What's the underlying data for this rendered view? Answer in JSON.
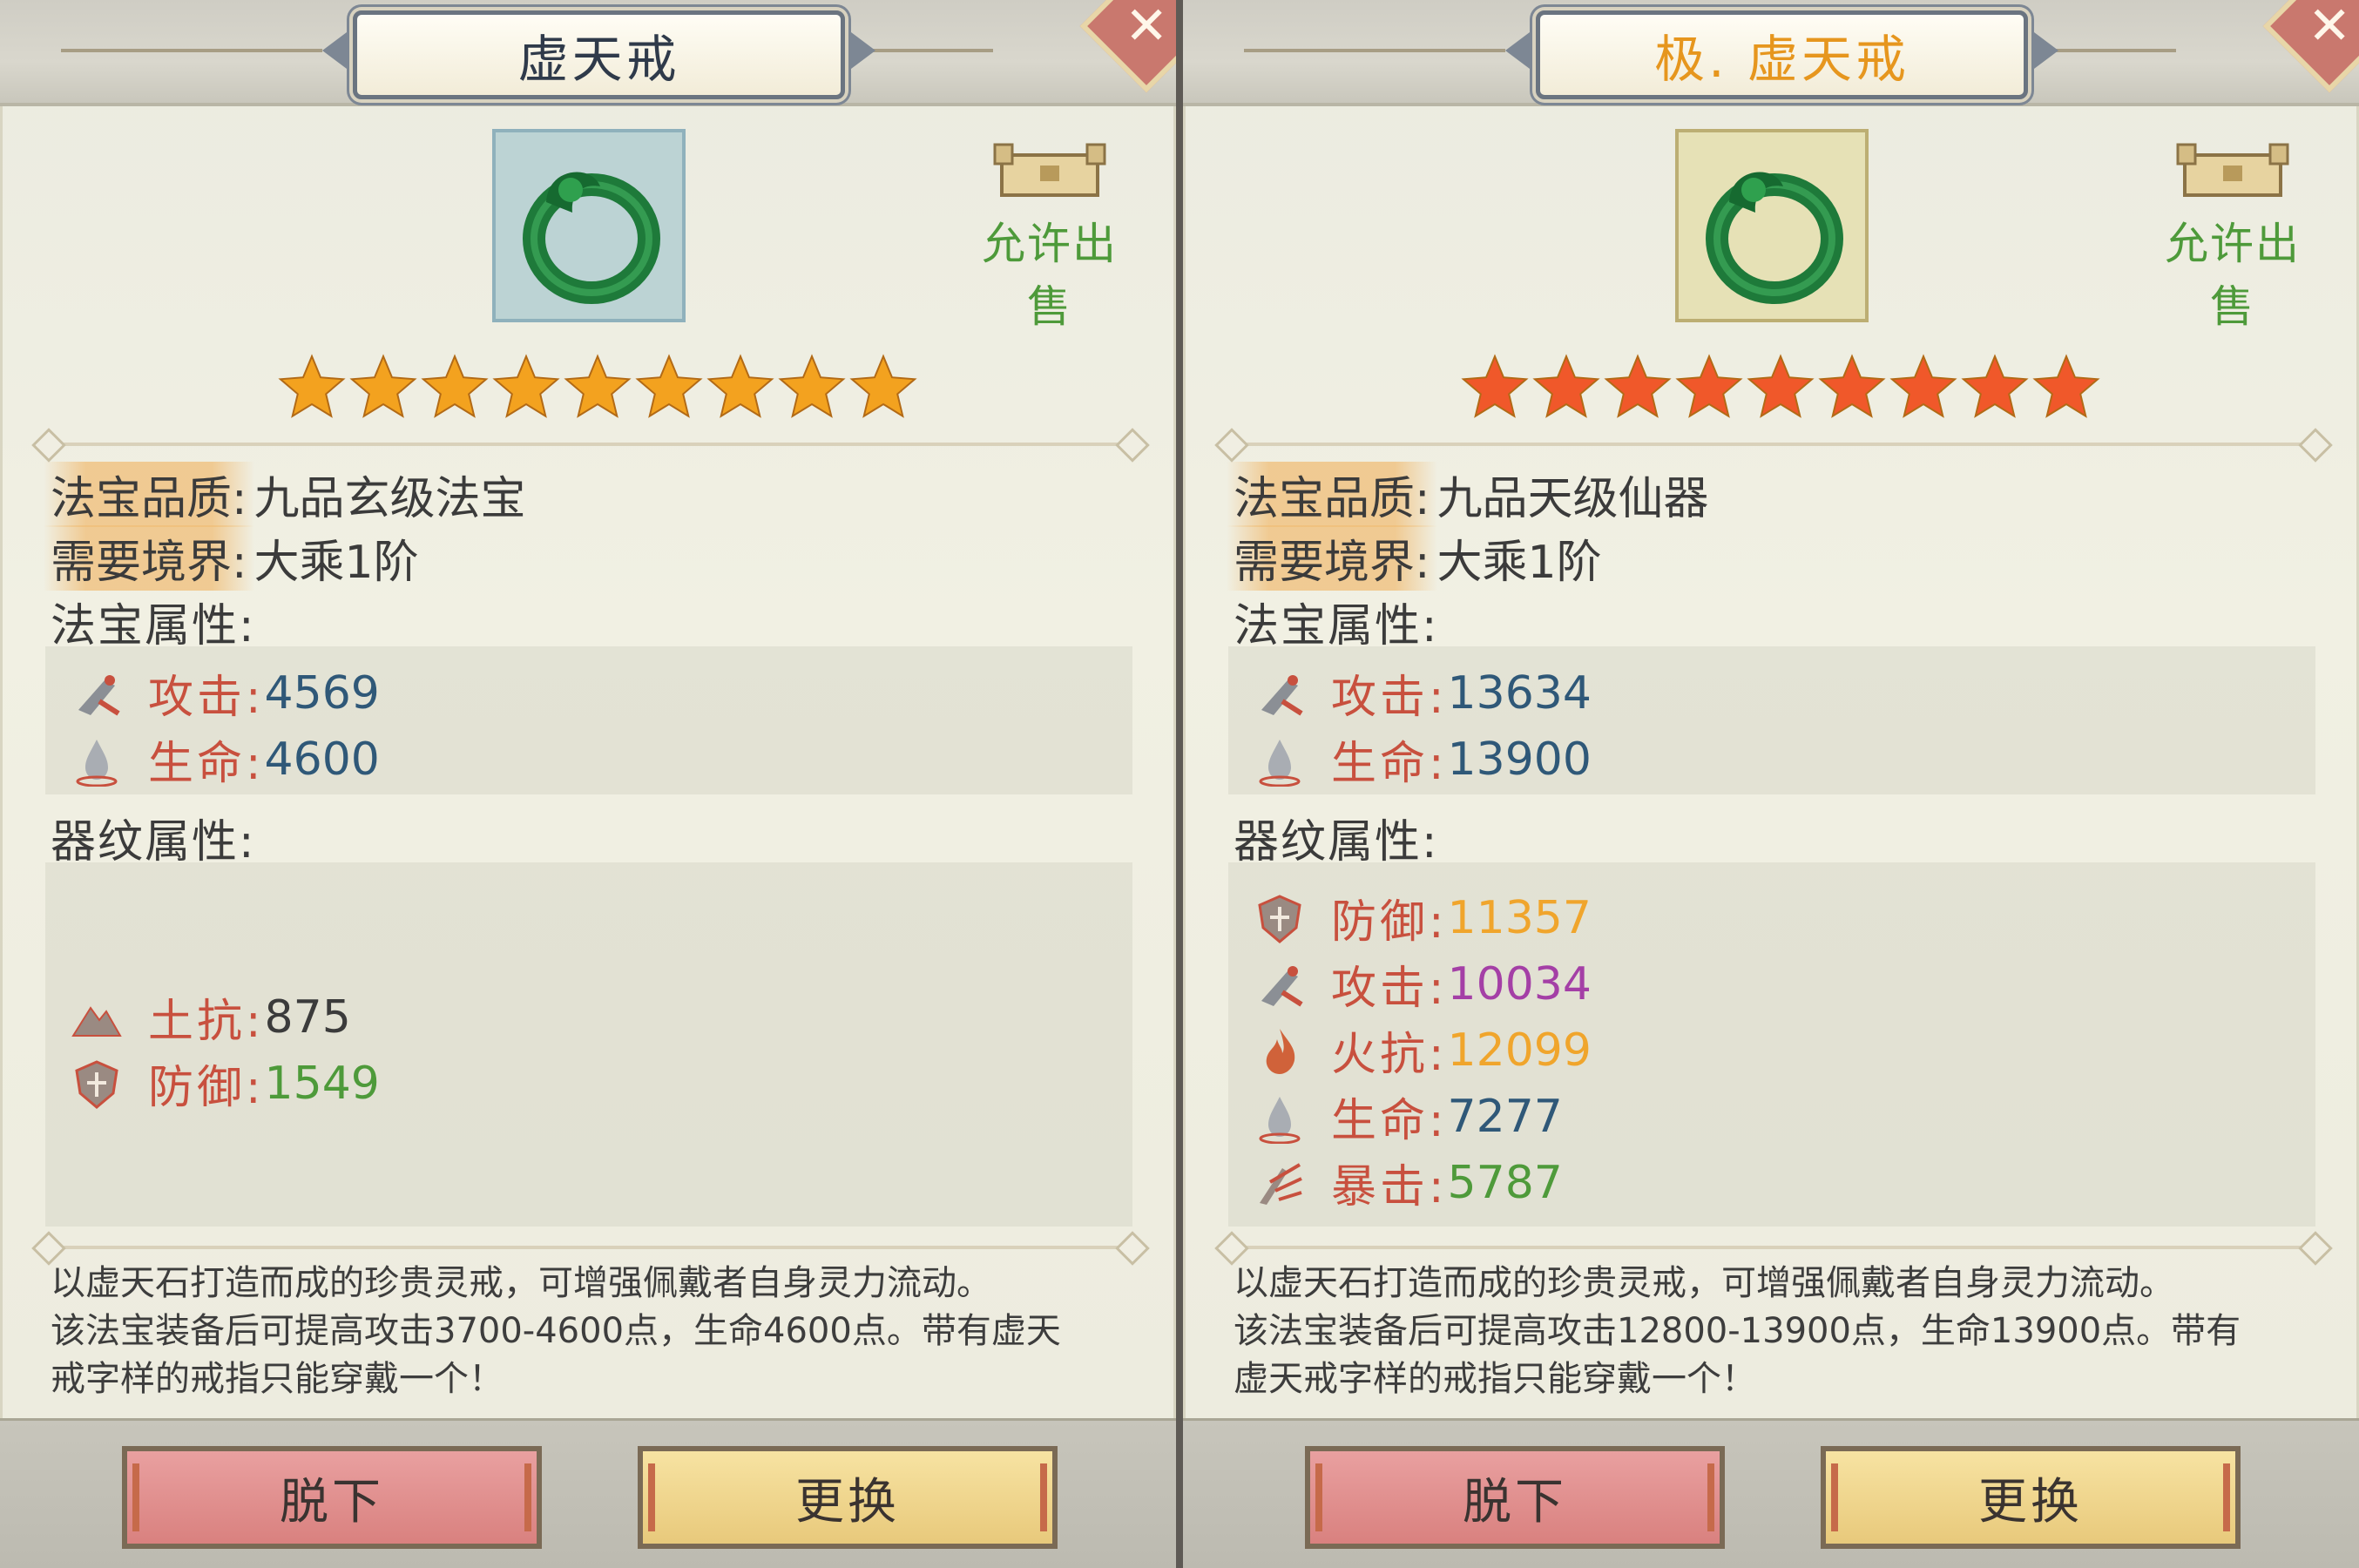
{
  "panels": [
    {
      "title": "虚天戒",
      "title_color": "#2f3a4a",
      "item_bg": "#bcd3d4",
      "star_color": "#f3a21f",
      "star_count": 9,
      "sell_label": "允许出售",
      "quality_label": "法宝品质:",
      "quality_value": "九品玄级法宝",
      "realm_label": "需要境界:",
      "realm_value": "大乘1阶",
      "base_section": "法宝属性:",
      "base_attrs": [
        {
          "icon": "attack-icon",
          "label": "攻击:",
          "value": "4569",
          "color": "#2f5878"
        },
        {
          "icon": "life-icon",
          "label": "生命:",
          "value": "4600",
          "color": "#2f5878"
        }
      ],
      "pattern_section": "器纹属性:",
      "pattern_attrs": [
        {
          "icon": "earth-resist-icon",
          "label": "土抗:",
          "value": "875",
          "color": "#3b3b3b"
        },
        {
          "icon": "defense-icon",
          "label": "防御:",
          "value": "1549",
          "color": "#4e9a3a"
        }
      ],
      "description": [
        "以虚天石打造而成的珍贵灵戒，可增强佩戴者自身灵力流动。",
        "该法宝装备后可提高攻击3700-4600点，生命4600点。带有虚天",
        "戒字样的戒指只能穿戴一个！"
      ],
      "btn_remove": "脱下",
      "btn_replace": "更换"
    },
    {
      "title": "极. 虚天戒",
      "title_color": "#e6961e",
      "item_bg": "#e6e1b6",
      "star_color": "#f0582a",
      "star_count": 9,
      "sell_label": "允许出售",
      "quality_label": "法宝品质:",
      "quality_value": "九品天级仙器",
      "realm_label": "需要境界:",
      "realm_value": "大乘1阶",
      "base_section": "法宝属性:",
      "base_attrs": [
        {
          "icon": "attack-icon",
          "label": "攻击:",
          "value": "13634",
          "color": "#2f5878"
        },
        {
          "icon": "life-icon",
          "label": "生命:",
          "value": "13900",
          "color": "#2f5878"
        }
      ],
      "pattern_section": "器纹属性:",
      "pattern_attrs": [
        {
          "icon": "defense-icon",
          "label": "防御:",
          "value": "11357",
          "color": "#f0a52c"
        },
        {
          "icon": "attack-icon",
          "label": "攻击:",
          "value": "10034",
          "color": "#a43fa6"
        },
        {
          "icon": "fire-resist-icon",
          "label": "火抗:",
          "value": "12099",
          "color": "#f0a52c"
        },
        {
          "icon": "life-icon",
          "label": "生命:",
          "value": "7277",
          "color": "#2f5878"
        },
        {
          "icon": "crit-icon",
          "label": "暴击:",
          "value": "5787",
          "color": "#4e9a3a"
        }
      ],
      "description": [
        "以虚天石打造而成的珍贵灵戒，可增强佩戴者自身灵力流动。",
        "该法宝装备后可提高攻击12800-13900点，生命13900点。带有",
        "虚天戒字样的戒指只能穿戴一个！"
      ],
      "btn_remove": "脱下",
      "btn_replace": "更换"
    }
  ]
}
